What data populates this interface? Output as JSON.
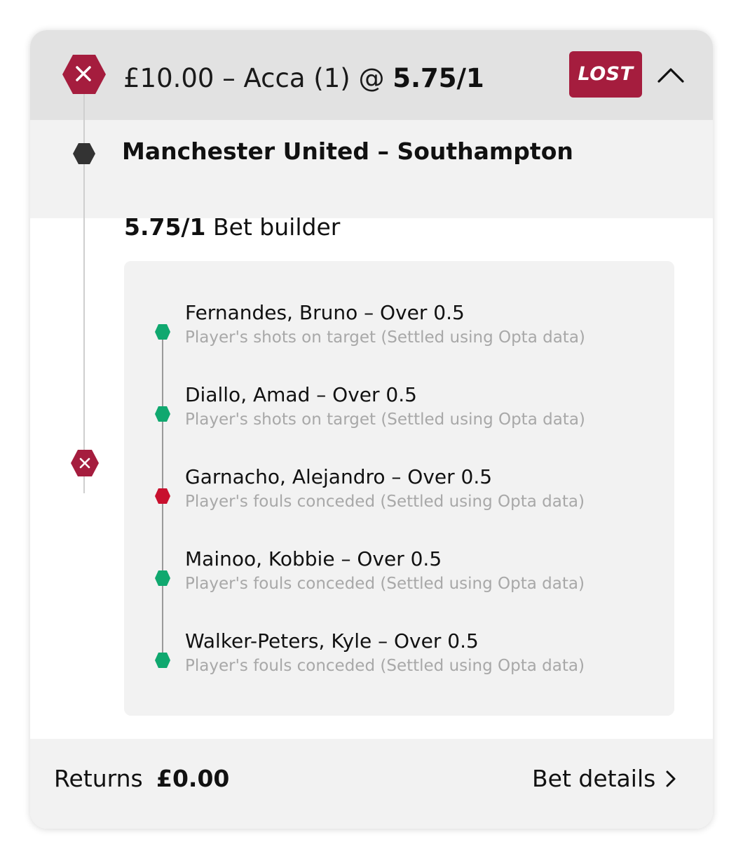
{
  "bet": {
    "title_prefix": "£10.00 – Acca (1) @",
    "title_odds": "5.75/1",
    "status": "LOST",
    "status_color": "#a51d3e"
  },
  "event": {
    "name": "Manchester United – Southampton"
  },
  "builder": {
    "odds": "5.75/1",
    "label": "Bet builder"
  },
  "selections": [
    {
      "name": "Fernandes, Bruno – Over 0.5",
      "market": "Player's shots on target (Settled using Opta data)",
      "result": "won",
      "color": "#10a86f"
    },
    {
      "name": "Diallo, Amad – Over 0.5",
      "market": "Player's shots on target (Settled using Opta data)",
      "result": "won",
      "color": "#10a86f"
    },
    {
      "name": "Garnacho, Alejandro – Over 0.5",
      "market": "Player's fouls conceded (Settled using Opta data)",
      "result": "lost",
      "color": "#c8102e"
    },
    {
      "name": "Mainoo, Kobbie – Over 0.5",
      "market": "Player's fouls conceded (Settled using Opta data)",
      "result": "won",
      "color": "#10a86f"
    },
    {
      "name": "Walker-Peters, Kyle – Over 0.5",
      "market": "Player's fouls conceded (Settled using Opta data)",
      "result": "won",
      "color": "#10a86f"
    }
  ],
  "footer": {
    "returns_label": "Returns",
    "returns_value": "£0.00",
    "details_label": "Bet details"
  },
  "icons": {
    "status": "close-icon",
    "collapse": "chevron-up-icon",
    "event": "hexagon-icon",
    "details": "chevron-right-icon"
  }
}
